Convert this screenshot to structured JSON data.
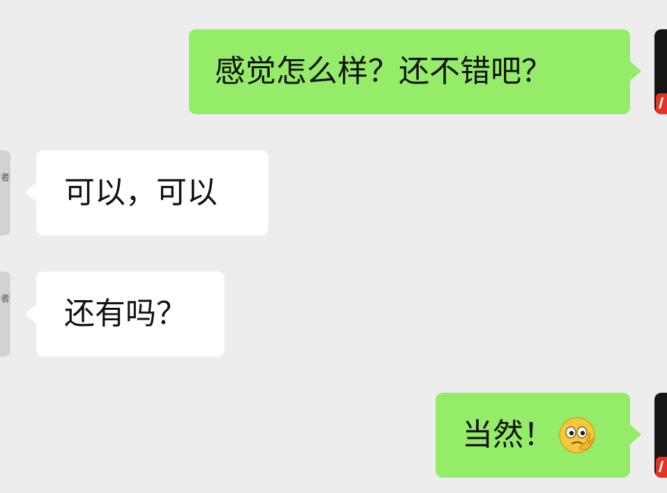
{
  "messages": [
    {
      "side": "out",
      "text": "感觉怎么样？还不错吧？"
    },
    {
      "side": "in",
      "text": "可以，可以",
      "avatar_glyph": "者"
    },
    {
      "side": "in",
      "text": "还有吗？",
      "avatar_glyph": "者"
    },
    {
      "side": "out",
      "text": "当然！",
      "emoji": "thinking-face-emoji"
    }
  ],
  "colors": {
    "background": "#ededed",
    "outgoing_bubble": "#95ec69",
    "incoming_bubble": "#ffffff",
    "text": "#111111"
  }
}
